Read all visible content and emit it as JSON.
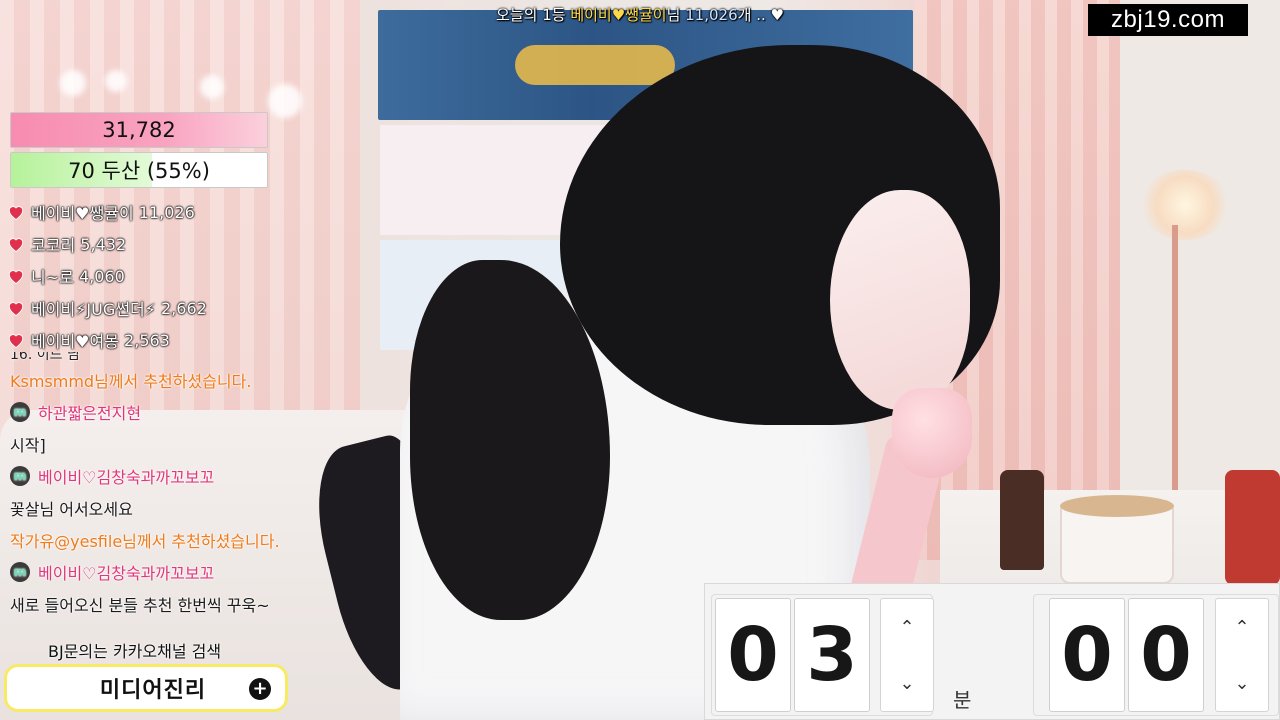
{
  "stream": {
    "top_banner": {
      "prefix": "오늘의 1등 ",
      "name": "베이비♥쌩귤이",
      "suffix": "님  ",
      "count": "11,026",
      "tail": "개 .. ♥"
    },
    "site_badge": "zbj19.com"
  },
  "progress": {
    "goal_value": "31,782",
    "level_label": "70 두산 (55%)",
    "level_percent": 55
  },
  "ranking": [
    {
      "name": "베이비♥쌩귤이",
      "count": "11,026"
    },
    {
      "name": "코코리",
      "count": "5,432"
    },
    {
      "name": "니~로",
      "count": "4,060"
    },
    {
      "name": "베이비⚡JUG썬더⚡",
      "count": "2,662"
    },
    {
      "name": "베이비♥여몽",
      "count": "2,563"
    }
  ],
  "chat": {
    "partial_line": "16. 이드 님",
    "lines": [
      {
        "type": "system",
        "text": "Ksmsmmd님께서 추천하셨습니다."
      },
      {
        "type": "user",
        "name": "하관짧은전지현"
      },
      {
        "type": "text",
        "text": "시작]"
      },
      {
        "type": "user",
        "name": "베이비♡김창숙과까꼬보꼬"
      },
      {
        "type": "text",
        "text": "꽃살님 어서오세요"
      },
      {
        "type": "system",
        "text": "작가유@yesfile님께서 추천하셨습니다."
      },
      {
        "type": "user",
        "name": "베이비♡김창숙과까꼬보꼬"
      },
      {
        "type": "text",
        "text": "새로 들어오신 분들 추천 한번씩 꾸욱~"
      }
    ],
    "badge_letter": "m",
    "notice": "BJ문의는 카카오채널 검색",
    "cta_label": "미디어진리",
    "cta_plus": "+"
  },
  "timer": {
    "minutes": [
      "0",
      "3"
    ],
    "seconds": [
      "0",
      "0"
    ],
    "minutes_unit": "분",
    "up_glyph": "⌃",
    "down_glyph": "⌄"
  },
  "colors": {
    "system_text": "#f07b1a",
    "username": "#e2367a",
    "heart": "#e0304e",
    "cta_border": "#f8ea65",
    "site_badge_bg": "#000000"
  }
}
